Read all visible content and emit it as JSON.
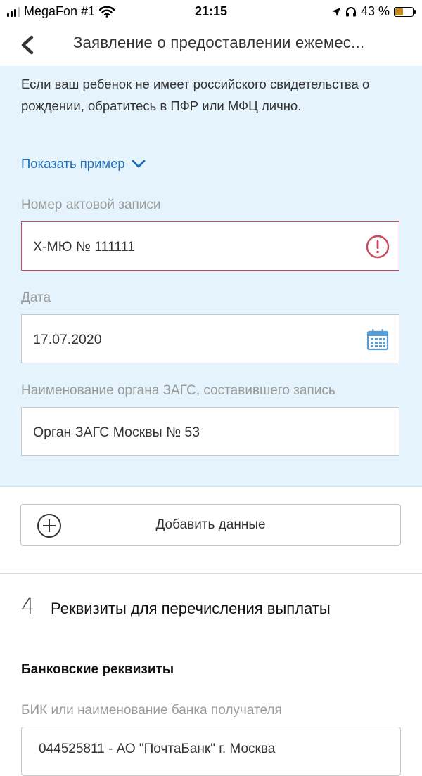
{
  "status_bar": {
    "carrier": "MegaFon #1",
    "time": "21:15",
    "battery": "43 %",
    "battery_level": 0.43
  },
  "nav": {
    "title": "Заявление о предоставлении ежемес..."
  },
  "info": {
    "notice": "Если ваш ребенок не имеет российского свидетельства о рождении, обратитесь в ПФР или МФЦ лично.",
    "show_example": "Показать пример"
  },
  "fields": {
    "record_number": {
      "label": "Номер актовой записи",
      "value": "Х-МЮ № 111111"
    },
    "date": {
      "label": "Дата",
      "value": "17.07.2020"
    },
    "registry_office": {
      "label": "Наименование органа ЗАГС, составившего запись",
      "value": "Орган ЗАГС Москвы № 53"
    }
  },
  "add_data_button": "Добавить данные",
  "section": {
    "number": "4",
    "title": "Реквизиты для перечисления выплаты"
  },
  "bank": {
    "heading": "Банковские реквизиты",
    "label": "БИК или наименование банка получателя",
    "value": "044525811 - АО \"ПочтаБанк\" г. Москва"
  },
  "colors": {
    "accent": "#1e6fb8",
    "error": "#c9485b",
    "panel_bg": "#e5f3fc",
    "calendar_icon": "#5a9bd0"
  },
  "icons": [
    "back-chevron-icon",
    "chevron-down-icon",
    "error-icon",
    "calendar-icon",
    "plus-circle-icon"
  ]
}
